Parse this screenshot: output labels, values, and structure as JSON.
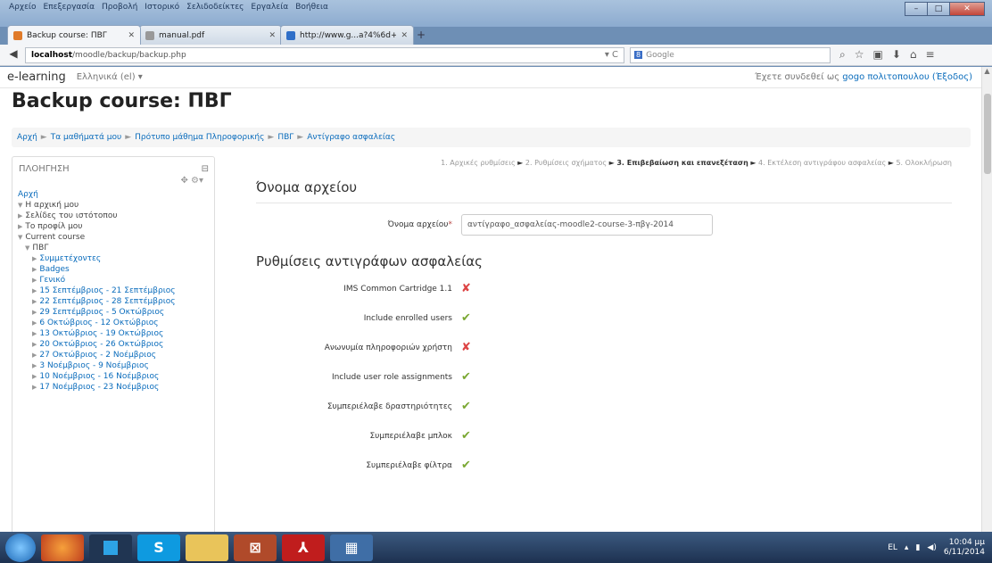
{
  "browser": {
    "menu": [
      "Αρχείο",
      "Επεξεργασία",
      "Προβολή",
      "Ιστορικό",
      "Σελιδοδείκτες",
      "Εργαλεία",
      "Βοήθεια"
    ],
    "tabs": [
      {
        "label": "Backup course: ΠΒΓ"
      },
      {
        "label": "manual.pdf"
      },
      {
        "label": "http://www.g...a?4%6d+a2s"
      }
    ],
    "url_host": "localhost",
    "url_path": "/moodle/backup/backup.php",
    "search_placeholder": "Google"
  },
  "page": {
    "site_name": "e-learning",
    "language": "Ελληνικά (el) ▾",
    "login_text": "Έχετε συνδεθεί ως",
    "login_user": "gogo πολιτοπουλου",
    "logout": "(Έξοδος)",
    "title": "Backup course: ΠΒΓ",
    "breadcrumb": [
      "Αρχή",
      "Τα μαθήματά μου",
      "Πρότυπο μάθημα Πληροφορικής",
      "ΠΒΓ",
      "Αντίγραφο ασφαλείας"
    ]
  },
  "nav_block": {
    "title": "ΠΛΟΗΓΗΣΗ",
    "items": [
      {
        "text": "Αρχή",
        "indent": 0,
        "tri": ""
      },
      {
        "text": "Η αρχική μου",
        "indent": 0,
        "tri": "▼"
      },
      {
        "text": "Σελίδες του ιστότοπου",
        "indent": 0,
        "tri": "▶"
      },
      {
        "text": "Το προφίλ μου",
        "indent": 0,
        "tri": "▶"
      },
      {
        "text": "Current course",
        "indent": 0,
        "tri": "▼"
      },
      {
        "text": "ΠΒΓ",
        "indent": 1,
        "tri": "▼"
      },
      {
        "text": "Συμμετέχοντες",
        "indent": 2,
        "tri": "▶"
      },
      {
        "text": "Badges",
        "indent": 2,
        "tri": "▶"
      },
      {
        "text": "Γενικό",
        "indent": 2,
        "tri": "▶"
      },
      {
        "text": "15 Σεπτέμβριος - 21 Σεπτέμβριος",
        "indent": 2,
        "tri": "▶"
      },
      {
        "text": "22 Σεπτέμβριος - 28 Σεπτέμβριος",
        "indent": 2,
        "tri": "▶"
      },
      {
        "text": "29 Σεπτέμβριος - 5 Οκτώβριος",
        "indent": 2,
        "tri": "▶"
      },
      {
        "text": "6 Οκτώβριος - 12 Οκτώβριος",
        "indent": 2,
        "tri": "▶"
      },
      {
        "text": "13 Οκτώβριος - 19 Οκτώβριος",
        "indent": 2,
        "tri": "▶"
      },
      {
        "text": "20 Οκτώβριος - 26 Οκτώβριος",
        "indent": 2,
        "tri": "▶"
      },
      {
        "text": "27 Οκτώβριος - 2 Νοέμβριος",
        "indent": 2,
        "tri": "▶"
      },
      {
        "text": "3 Νοέμβριος - 9 Νοέμβριος",
        "indent": 2,
        "tri": "▶"
      },
      {
        "text": "10 Νοέμβριος - 16 Νοέμβριος",
        "indent": 2,
        "tri": "▶"
      },
      {
        "text": "17 Νοέμβριος - 23 Νοέμβριος",
        "indent": 2,
        "tri": "▶"
      }
    ]
  },
  "main": {
    "steps": [
      {
        "text": "1. Αρχικές ρυθμίσεις",
        "current": false
      },
      {
        "text": "2. Ρυθμίσεις σχήματος",
        "current": false
      },
      {
        "text": "3. Επιβεβαίωση και επανεξέταση",
        "current": true
      },
      {
        "text": "4. Εκτέλεση αντιγράφου ασφαλείας",
        "current": false
      },
      {
        "text": "5. Ολοκλήρωση",
        "current": false
      }
    ],
    "filename_section": "Όνομα αρχείου",
    "filename_label": "Όνομα αρχείου",
    "filename_value": "αντίγραφο_ασφαλείας-moodle2-course-3-πβγ-2014",
    "settings_section": "Ρυθμίσεις αντιγράφων ασφαλείας",
    "settings": [
      {
        "label": "IMS Common Cartridge 1.1",
        "enabled": false
      },
      {
        "label": "Include enrolled users",
        "enabled": true
      },
      {
        "label": "Ανωνυμία πληροφοριών χρήστη",
        "enabled": false
      },
      {
        "label": "Include user role assignments",
        "enabled": true
      },
      {
        "label": "Συμπεριέλαβε δραστηριότητες",
        "enabled": true
      },
      {
        "label": "Συμπεριέλαβε μπλοκ",
        "enabled": true
      },
      {
        "label": "Συμπεριέλαβε φίλτρα",
        "enabled": true
      }
    ]
  },
  "taskbar": {
    "lang": "EL",
    "time": "10:04 μμ",
    "date": "6/11/2014"
  }
}
